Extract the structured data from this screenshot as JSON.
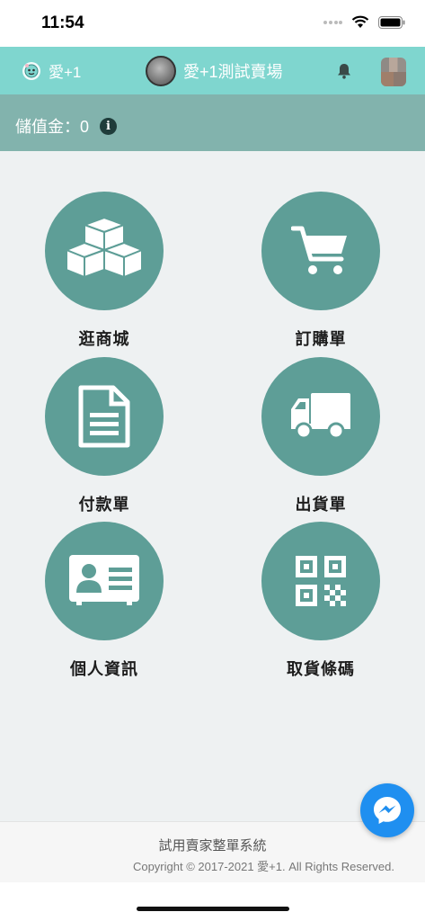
{
  "status_bar": {
    "time": "11:54"
  },
  "header": {
    "brand_label": "愛+1",
    "store_name": "愛+1測試賣場"
  },
  "balance": {
    "label": "儲值金：0"
  },
  "menu": {
    "shop": "逛商城",
    "orders": "訂購單",
    "payment": "付款單",
    "shipment": "出貨單",
    "profile": "個人資訊",
    "pickup_code": "取貨條碼"
  },
  "footer": {
    "title": "試用賣家整單系統",
    "copyright": "Copyright © 2017-2021 愛+1. All Rights Reserved."
  },
  "colors": {
    "header": "#7fd6cf",
    "balance_bar": "#82b3ad",
    "tile_circle": "#5e9e97",
    "background": "#eef1f2",
    "messenger": "#1f8ff0"
  }
}
